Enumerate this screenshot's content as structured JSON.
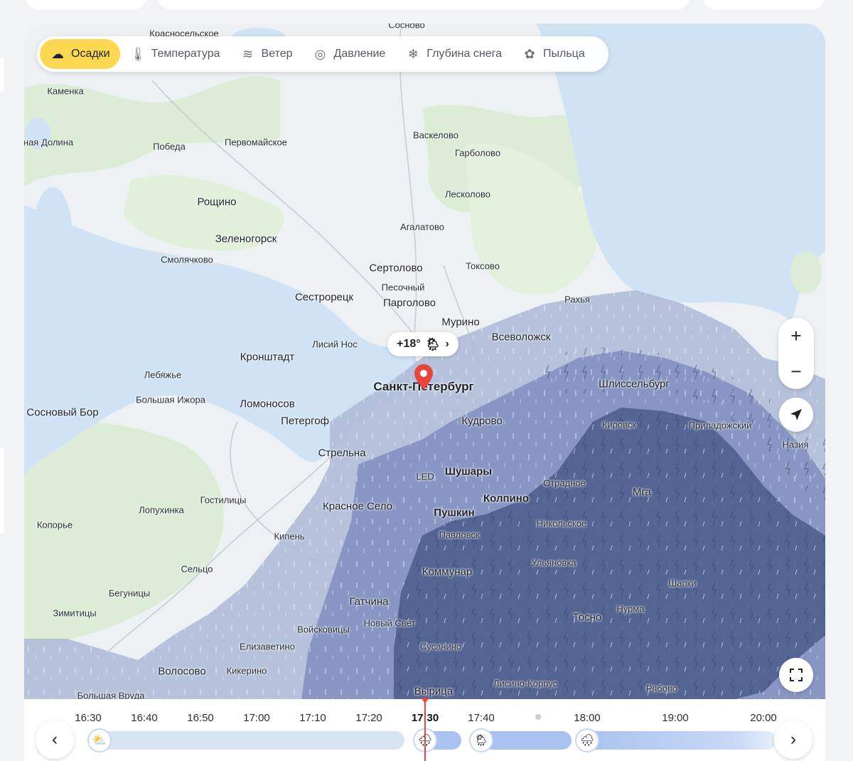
{
  "tabs": [
    {
      "label": "Осадки",
      "icon": "precipitation-icon"
    },
    {
      "label": "Температура",
      "icon": "thermometer-icon"
    },
    {
      "label": "Ветер",
      "icon": "wind-icon"
    },
    {
      "label": "Давление",
      "icon": "pressure-icon"
    },
    {
      "label": "Глубина снега",
      "icon": "snowflake-icon"
    },
    {
      "label": "Пыльца",
      "icon": "pollen-icon"
    }
  ],
  "active_tab": "Осадки",
  "weather_bubble": {
    "temp": "+18°"
  },
  "places": [
    {
      "name": "Красносельское"
    },
    {
      "name": "Сосново"
    },
    {
      "name": "Каменка"
    },
    {
      "name": "ная Долина"
    },
    {
      "name": "Победа"
    },
    {
      "name": "Первомайское"
    },
    {
      "name": "Васкелово"
    },
    {
      "name": "Гарболово"
    },
    {
      "name": "Лесколово"
    },
    {
      "name": "Рощино"
    },
    {
      "name": "Агалатово"
    },
    {
      "name": "Зеленогорск"
    },
    {
      "name": "Смолячково"
    },
    {
      "name": "Сертолово"
    },
    {
      "name": "Токсово"
    },
    {
      "name": "Песочный"
    },
    {
      "name": "Сестрорецк"
    },
    {
      "name": "Парголово"
    },
    {
      "name": "Рахья"
    },
    {
      "name": "Мурино"
    },
    {
      "name": "Всеволожск"
    },
    {
      "name": "Лисий Нос"
    },
    {
      "name": "Кронштадт"
    },
    {
      "name": "Лебяжье"
    },
    {
      "name": "Шлиссельбург"
    },
    {
      "name": "Санкт-Петербург"
    },
    {
      "name": "Большая Ижора"
    },
    {
      "name": "Ломоносов"
    },
    {
      "name": "Сосновый Бор"
    },
    {
      "name": "Петергоф"
    },
    {
      "name": "Кудрово"
    },
    {
      "name": "Кировск"
    },
    {
      "name": "Приладожский"
    },
    {
      "name": "Назия"
    },
    {
      "name": "Стрельна"
    },
    {
      "name": "Шушары"
    },
    {
      "name": "LED"
    },
    {
      "name": "Отрадное"
    },
    {
      "name": "Мга"
    },
    {
      "name": "Гостилицы"
    },
    {
      "name": "Колпино"
    },
    {
      "name": "Лопухинка"
    },
    {
      "name": "Красное Село"
    },
    {
      "name": "Пушкин"
    },
    {
      "name": "Копорье"
    },
    {
      "name": "Никольское"
    },
    {
      "name": "Кипень"
    },
    {
      "name": "Павловск"
    },
    {
      "name": "Ульяновка"
    },
    {
      "name": "Сельцо"
    },
    {
      "name": "Коммунар"
    },
    {
      "name": "Шапки"
    },
    {
      "name": "Бегуницы"
    },
    {
      "name": "Гатчина"
    },
    {
      "name": "Нурма"
    },
    {
      "name": "Зимитицы"
    },
    {
      "name": "Тосно"
    },
    {
      "name": "Новый Свет"
    },
    {
      "name": "Войсковицы"
    },
    {
      "name": "Елизаветино"
    },
    {
      "name": "Сусанино"
    },
    {
      "name": "Волосово"
    },
    {
      "name": "Кикерино"
    },
    {
      "name": "Лисино-Корпус"
    },
    {
      "name": "Рябово"
    },
    {
      "name": "Вырица"
    },
    {
      "name": "Большая Вруда"
    }
  ],
  "timeline": {
    "labels": [
      "16:30",
      "16:40",
      "16:50",
      "17:00",
      "17:10",
      "17:20",
      "17:30",
      "17:40",
      "18:00",
      "19:00",
      "20:00"
    ],
    "current": "17:30"
  },
  "colors": {
    "active_tab": "#fcd852",
    "precip_light": "#aebbd8",
    "precip_mid": "#8393bf",
    "precip_heavy": "#4d5f8c",
    "marker": "#e8453c",
    "water": "#cfe3f5",
    "land": "#eef1f4"
  }
}
